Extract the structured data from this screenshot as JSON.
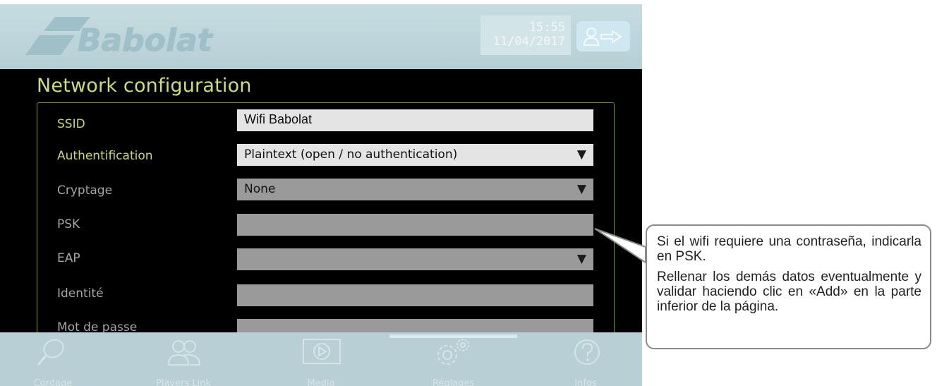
{
  "header": {
    "brand": "Babolat",
    "time": "15:55",
    "date": "11/04/2017",
    "logout_icon": "user-logout-icon"
  },
  "page": {
    "title": "Network configuration"
  },
  "form": {
    "ssid": {
      "label": "SSID",
      "value": "Wifi Babolat"
    },
    "authentification": {
      "label": "Authentification",
      "value": "Plaintext (open / no authentication)"
    },
    "cryptage": {
      "label": "Cryptage",
      "value": "None"
    },
    "psk": {
      "label": "PSK",
      "value": ""
    },
    "eap": {
      "label": "EAP",
      "value": ""
    },
    "identite": {
      "label": "Identité",
      "value": ""
    },
    "mot_de_passe": {
      "label": "Mot de passe",
      "value": ""
    },
    "dropdown_arrow": "▼"
  },
  "nav": {
    "items": [
      {
        "label": "Cordage",
        "icon": "racket-icon"
      },
      {
        "label": "Players Link",
        "icon": "players-icon"
      },
      {
        "label": "Media",
        "icon": "play-icon"
      },
      {
        "label": "Réglages",
        "icon": "gears-icon"
      },
      {
        "label": "Infos",
        "icon": "help-icon"
      }
    ],
    "active": "Réglages"
  },
  "callout": {
    "line1": "Si el wifi requiere una contraseña, indicarla en PSK.",
    "line2": "Rellenar los demás datos eventualmente y validar haciendo clic en «Add» en la parte inferior de la página."
  },
  "colors": {
    "header_bg": "#b6cfd5",
    "title": "#c9dd7f",
    "active_label": "#c3d67a",
    "field_disabled": "#9a9a9a",
    "field_enabled": "#e4e4e4"
  }
}
